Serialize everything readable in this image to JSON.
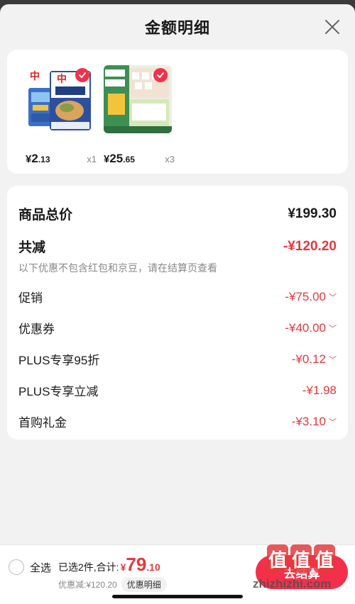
{
  "sheet": {
    "title": "金额明细"
  },
  "products": [
    {
      "price_symbol": "¥",
      "price_int": "2",
      "price_dec": ".13",
      "qty": "x1"
    },
    {
      "price_symbol": "¥",
      "price_int": "25",
      "price_dec": ".65",
      "qty": "x3"
    }
  ],
  "detail": {
    "total_label": "商品总价",
    "total_value": "¥199.30",
    "reduction_label": "共减",
    "reduction_value": "-¥120.20",
    "note": "以下优惠不包含红包和京豆，请在结算页查看",
    "items": [
      {
        "label": "促销",
        "value": "-¥75.00"
      },
      {
        "label": "优惠券",
        "value": "-¥40.00"
      },
      {
        "label": "PLUS专享95折",
        "value": "-¥0.12"
      },
      {
        "label": "PLUS专享立减",
        "value": "-¥1.98"
      },
      {
        "label": "首购礼金",
        "value": "-¥3.10"
      }
    ]
  },
  "bottom": {
    "select_all": "全选",
    "selected_text": "已选2件,合计:",
    "total_symbol": "¥",
    "total_int": "79",
    "total_dec": ".10",
    "discount_text": "优惠减:¥120.20",
    "detail_link": "优惠明细",
    "checkout": "去结算"
  },
  "watermark": {
    "chars": [
      "值",
      "值",
      "值"
    ],
    "text": "zhizhizhi.com"
  },
  "colors": {
    "accent": "#e4393c",
    "badge": "#f3304b"
  },
  "icons": {
    "close": "close-icon",
    "check": "check-icon",
    "chevron": "chevron-down-icon"
  }
}
